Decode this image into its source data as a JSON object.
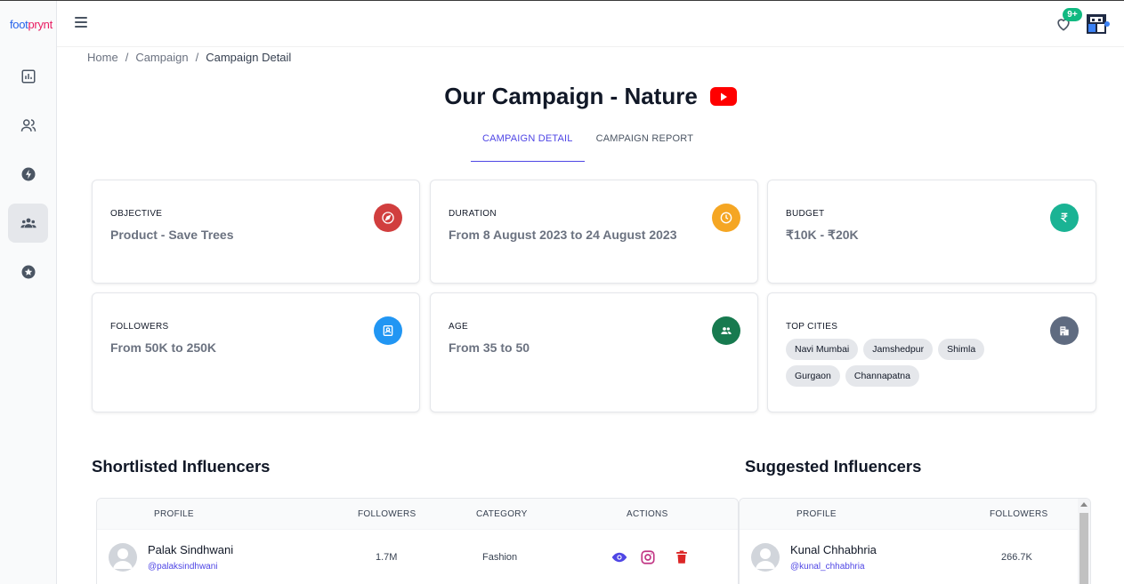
{
  "brand": {
    "logo_part1": "foot",
    "logo_part2": "prynt"
  },
  "sidebar": {
    "items": [
      {
        "name": "dashboard",
        "icon": "bar-chart-icon"
      },
      {
        "name": "users",
        "icon": "users-icon"
      },
      {
        "name": "campaigns",
        "icon": "bolt-icon"
      },
      {
        "name": "influencers",
        "icon": "group-icon",
        "active": true
      },
      {
        "name": "favorites",
        "icon": "star-icon"
      }
    ]
  },
  "header": {
    "notification_count": "9+"
  },
  "breadcrumb": {
    "home": "Home",
    "sep1": "/",
    "campaign": "Campaign",
    "sep2": "/",
    "current": "Campaign Detail"
  },
  "page": {
    "title": "Our Campaign - Nature",
    "platform_icon": "youtube-icon"
  },
  "tabs": {
    "detail": "CAMPAIGN DETAIL",
    "report": "CAMPAIGN REPORT"
  },
  "cards": {
    "objective": {
      "label": "OBJECTIVE",
      "value": "Product - Save Trees",
      "color": "#d13e3e"
    },
    "duration": {
      "label": "DURATION",
      "value": "From 8 August 2023 to 24 August 2023",
      "color": "#f5a623"
    },
    "budget": {
      "label": "BUDGET",
      "value": "₹10K - ₹20K",
      "color": "#1ab394"
    },
    "followers": {
      "label": "FOLLOWERS",
      "value": "From 50K to 250K",
      "color": "#2196f3"
    },
    "age": {
      "label": "AGE",
      "value": "From 35 to 50",
      "color": "#177a4f"
    },
    "top_cities": {
      "label": "TOP CITIES",
      "color": "#5f6b80",
      "cities": [
        "Navi Mumbai",
        "Jamshedpur",
        "Shimla",
        "Gurgaon",
        "Channapatna"
      ]
    }
  },
  "shortlisted": {
    "title": "Shortlisted Influencers",
    "headers": {
      "profile": "PROFILE",
      "followers": "FOLLOWERS",
      "category": "CATEGORY",
      "actions": "ACTIONS"
    },
    "rows": [
      {
        "name": "Palak Sindhwani",
        "handle": "@palaksindhwani",
        "followers": "1.7M",
        "category": "Fashion"
      }
    ]
  },
  "suggested": {
    "title": "Suggested Influencers",
    "headers": {
      "profile": "PROFILE",
      "followers": "FOLLOWERS"
    },
    "rows": [
      {
        "name": "Kunal Chhabhria",
        "handle": "@kunal_chhabhria",
        "followers": "266.7K"
      }
    ]
  },
  "colors": {
    "accent": "#4f46e5",
    "instagram": "#c13584",
    "delete": "#dc2626",
    "badge": "#10b981"
  }
}
